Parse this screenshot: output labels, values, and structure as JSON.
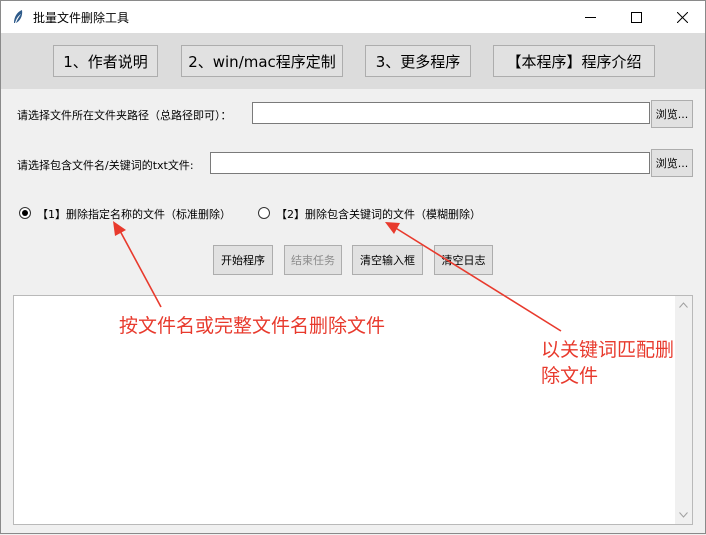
{
  "window": {
    "title": "批量文件删除工具",
    "controls": [
      "minimize",
      "maximize",
      "close"
    ]
  },
  "top_buttons": [
    {
      "label": "1、作者说明"
    },
    {
      "label": "2、win/mac程序定制"
    },
    {
      "label": "3、更多程序"
    },
    {
      "label": "【本程序】程序介绍"
    }
  ],
  "folder_path": {
    "label": "请选择文件所在文件夹路径（总路径即可）：",
    "value": "",
    "browse_label": "浏览..."
  },
  "txt_file": {
    "label": "请选择包含文件名/关键词的txt文件:",
    "value": "",
    "browse_label": "浏览..."
  },
  "modes": [
    {
      "label": "【1】删除指定名称的文件（标准删除）",
      "checked": true
    },
    {
      "label": "【2】删除包含关键词的文件（模糊删除）",
      "checked": false
    }
  ],
  "actions": [
    {
      "label": "开始程序",
      "disabled": false
    },
    {
      "label": "结束任务",
      "disabled": true
    },
    {
      "label": "清空输入框",
      "disabled": false
    },
    {
      "label": "清空日志",
      "disabled": false
    }
  ],
  "log": {
    "content": ""
  },
  "annotations": {
    "left": "按文件名或完整文件名删除文件",
    "right_line1": "以关键词匹配删",
    "right_line2": "除文件",
    "color": "#e83a2d"
  }
}
